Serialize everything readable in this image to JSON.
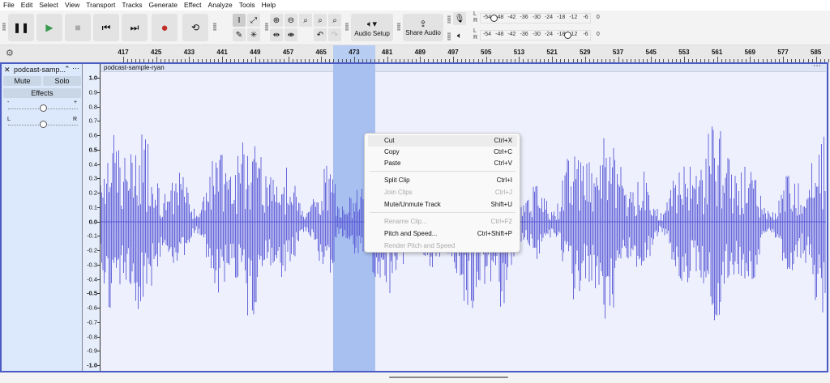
{
  "menubar": [
    "File",
    "Edit",
    "Select",
    "View",
    "Transport",
    "Tracks",
    "Generate",
    "Effect",
    "Analyze",
    "Tools",
    "Help"
  ],
  "toolbar": {
    "audio_setup": "Audio Setup",
    "share_audio": "Share Audio"
  },
  "meters": {
    "record": {
      "L": "L",
      "R": "R",
      "ticks": [
        "-54",
        "-48",
        "-42",
        "-36",
        "-30",
        "-24",
        "-18",
        "-12",
        "-6",
        "0"
      ],
      "level_db": -51
    },
    "playback": {
      "L": "L",
      "R": "R",
      "ticks": [
        "-54",
        "-48",
        "-42",
        "-36",
        "-30",
        "-24",
        "-18",
        "-12",
        "-6",
        "0"
      ],
      "level_db": -15
    }
  },
  "ruler": {
    "labels": [
      "417",
      "425",
      "433",
      "441",
      "449",
      "457",
      "465",
      "473",
      "481",
      "489",
      "497",
      "505",
      "513",
      "521",
      "529",
      "537",
      "545",
      "553",
      "561",
      "569",
      "577",
      "585"
    ],
    "selection": "473"
  },
  "track": {
    "name": "podcast-samp...",
    "clip_name": "podcast-sample-ryan",
    "mute": "Mute",
    "solo": "Solo",
    "effects": "Effects",
    "gain_minus": "-",
    "gain_plus": "+",
    "pan_left": "L",
    "pan_right": "R",
    "gain": 0.5,
    "pan": 0.5
  },
  "scale": [
    "1.0",
    "0.9",
    "0.8",
    "0.7",
    "0.6",
    "0.5",
    "0.4",
    "0.3",
    "0.2",
    "0.1",
    "0.0",
    "-0.1",
    "-0.2",
    "-0.3",
    "-0.4",
    "-0.5",
    "-0.6",
    "-0.7",
    "-0.8",
    "-0.9",
    "-1.0"
  ],
  "context_menu": [
    {
      "label": "Cut",
      "shortcut": "Ctrl+X",
      "enabled": true
    },
    {
      "label": "Copy",
      "shortcut": "Ctrl+C",
      "enabled": true
    },
    {
      "label": "Paste",
      "shortcut": "Ctrl+V",
      "enabled": true
    },
    {
      "label": "Split Clip",
      "shortcut": "Ctrl+I",
      "enabled": true
    },
    {
      "label": "Join Clips",
      "shortcut": "Ctrl+J",
      "enabled": false
    },
    {
      "label": "Mute/Unmute Track",
      "shortcut": "Shift+U",
      "enabled": true
    },
    {
      "label": "Rename Clip...",
      "shortcut": "Ctrl+F2",
      "enabled": false
    },
    {
      "label": "Pitch and Speed...",
      "shortcut": "Ctrl+Shift+P",
      "enabled": true
    },
    {
      "label": "Render Pitch and Speed",
      "shortcut": "",
      "enabled": false
    }
  ],
  "colors": {
    "waveform": "#5a5ad6",
    "selection": "#a8c0f0",
    "track_border": "#4a5bc4",
    "record": "#c0302a",
    "play": "#3a9a50"
  }
}
